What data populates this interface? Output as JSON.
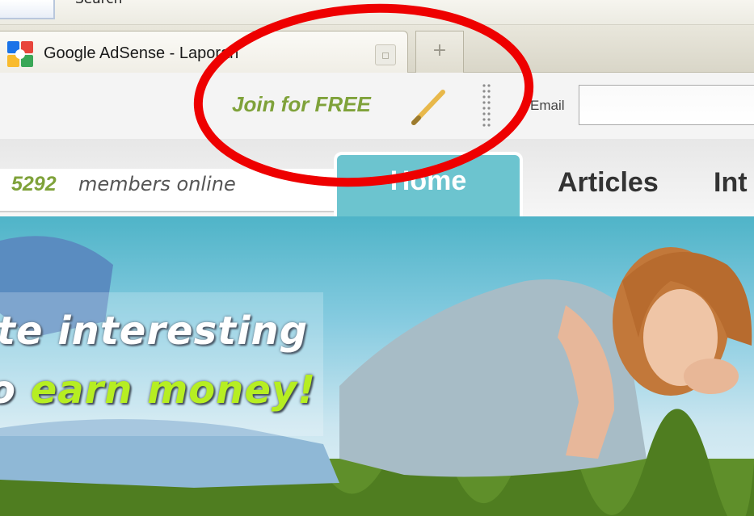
{
  "browser": {
    "menu_fragment": "Search",
    "tab_title": "Google AdSense - Laporan",
    "new_tab_symbol": "+"
  },
  "header": {
    "join_label": "Join for FREE",
    "email_label": "Email",
    "email_value": ""
  },
  "nav": {
    "members_count": "5292",
    "members_text": "members online",
    "tabs": [
      "Home",
      "Articles",
      "Int"
    ]
  },
  "hero": {
    "line1": "te interesting",
    "line2_prefix": "o ",
    "line2_accent": "earn money!"
  },
  "colors": {
    "accent_green": "#7fa23a",
    "tab_active": "#6cc4cf",
    "annotation_red": "#ee0000"
  },
  "icons": [
    "google-favicon-icon",
    "pencil-icon",
    "tab-close-icon",
    "new-tab-icon"
  ]
}
